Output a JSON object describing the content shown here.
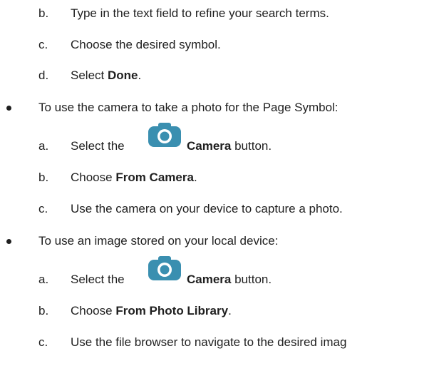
{
  "steps_a": [
    {
      "letter": "b.",
      "text": "Type in the text field to refine your search terms."
    },
    {
      "letter": "c.",
      "text": "Choose the desired symbol."
    },
    {
      "letter": "d.",
      "pre": "Select ",
      "bold": "Done",
      "post": "."
    }
  ],
  "bullet1": "To use the camera to take a photo for the Page Symbol:",
  "steps_b": [
    {
      "letter": "a.",
      "pre": "Select the",
      "bold": "Camera",
      "post": " button."
    },
    {
      "letter": "b.",
      "pre": "Choose ",
      "bold": "From Camera",
      "post": "."
    },
    {
      "letter": "c.",
      "text": "Use the camera on your device to capture a photo."
    }
  ],
  "bullet2": "To use an image stored on your local device:",
  "steps_c": [
    {
      "letter": "a.",
      "pre": "Select the",
      "bold": "Camera",
      "post": " button."
    },
    {
      "letter": "b.",
      "pre": "Choose ",
      "bold": "From Photo Library",
      "post": "."
    },
    {
      "letter": "c.",
      "text": "Use the file browser to navigate to the desired imag"
    }
  ],
  "colors": {
    "camera_icon": "#3a8fb0",
    "text": "#1f1f1f"
  }
}
